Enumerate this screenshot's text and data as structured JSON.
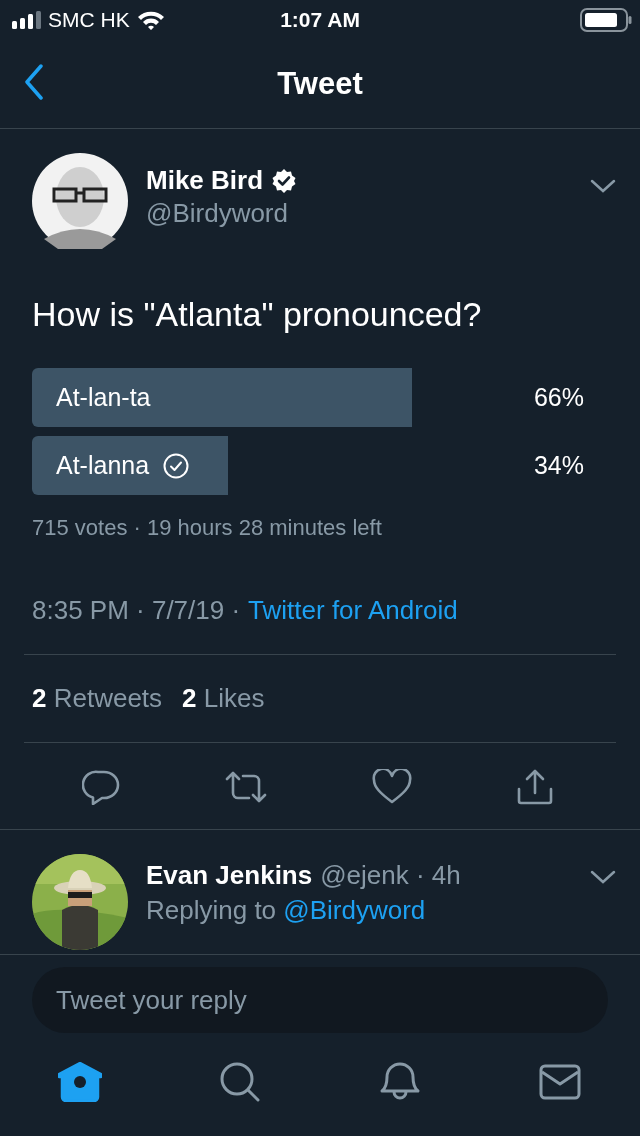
{
  "status_bar": {
    "carrier": "SMC HK",
    "time": "1:07 AM"
  },
  "nav": {
    "title": "Tweet"
  },
  "tweet": {
    "name": "Mike Bird",
    "verified": true,
    "handle": "@Birdyword",
    "text": "How is \"Atlanta\" pronounced?",
    "poll": {
      "options": [
        {
          "label": "At-lan-ta",
          "percent": "66%",
          "selected": false
        },
        {
          "label": "At-lanna",
          "percent": "34%",
          "selected": true
        }
      ],
      "summary": "715 votes · 19 hours 28 minutes left"
    },
    "timestamp": "8:35 PM · 7/7/19 ·",
    "source": "Twitter for Android",
    "retweets_count": "2",
    "retweets_label": "Retweets",
    "likes_count": "2",
    "likes_label": "Likes"
  },
  "reply": {
    "name": "Evan Jenkins",
    "handle": "@ejenk · 4h",
    "replying_prefix": "Replying to",
    "replying_to": "@Birdyword"
  },
  "composer": {
    "placeholder": "Tweet your reply"
  },
  "tab_bar": [
    {
      "kind": "home",
      "selected": true
    },
    {
      "kind": "search",
      "selected": false
    },
    {
      "kind": "notifications",
      "selected": false
    },
    {
      "kind": "messages",
      "selected": false
    }
  ]
}
